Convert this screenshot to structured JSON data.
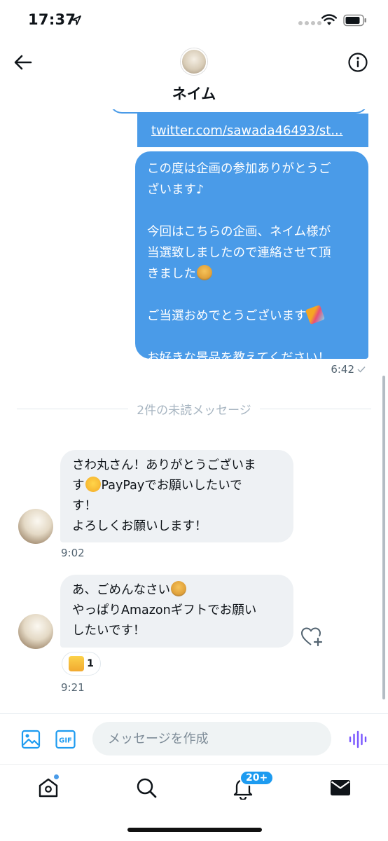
{
  "status_bar": {
    "time": "17:37"
  },
  "header": {
    "contact_name": "ネイム"
  },
  "messages": {
    "link_text": "twitter.com/sawada46493/st...",
    "sent": {
      "line1": "この度は企画の参加ありがとうご",
      "line2": "ざいます♪",
      "line3": "今回はこちらの企画、ネイム様が",
      "line4": "当選致しましたので連絡させて頂",
      "line5": "きました",
      "line6": "ご当選おめでとうございます",
      "line7": "お好きな景品を教えてください！",
      "time": "6:42"
    },
    "unread_label": "2件の未読メッセージ",
    "received_1": {
      "line1": "さわ丸さん！ありがとうございま",
      "line2a": "す",
      "line2b": "PayPayでお願いしたいで",
      "line3": "す！",
      "line4": "よろしくお願いします！",
      "time": "9:02"
    },
    "received_2": {
      "line1": "あ、ごめんなさい",
      "line2": "やっぱりAmazonギフトでお願い",
      "line3": "したいです！",
      "reaction_count": "1",
      "time": "9:21"
    }
  },
  "composer": {
    "placeholder": "メッセージを作成",
    "value": ""
  },
  "tabbar": {
    "notification_badge": "20+"
  },
  "colors": {
    "accent": "#1d9bf0",
    "sent_bubble": "#4a9be8",
    "received_bubble": "#eef1f4"
  }
}
